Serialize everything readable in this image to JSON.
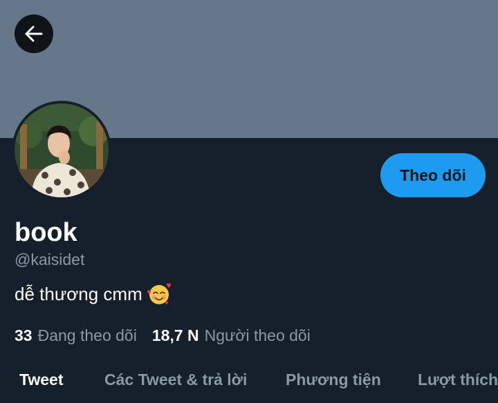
{
  "header": {
    "back_icon": "arrow-left-icon",
    "banner_color": "#66778a"
  },
  "profile": {
    "display_name": "book",
    "handle": "@kaisidet",
    "bio": "dễ thương cmm",
    "bio_emoji": "smiling-face-with-hearts-icon",
    "avatar": "profile-photo",
    "follow_label": "Theo dõi",
    "follow_color": "#1d9bf0"
  },
  "stats": {
    "following_count": "33",
    "following_label": "Đang theo dõi",
    "followers_count": "18,7 N",
    "followers_label": "Người theo dõi"
  },
  "tabs": [
    {
      "label": "Tweet",
      "active": true
    },
    {
      "label": "Các Tweet & trả lời",
      "active": false
    },
    {
      "label": "Phương tiện",
      "active": false
    },
    {
      "label": "Lượt thích",
      "active": false
    }
  ]
}
